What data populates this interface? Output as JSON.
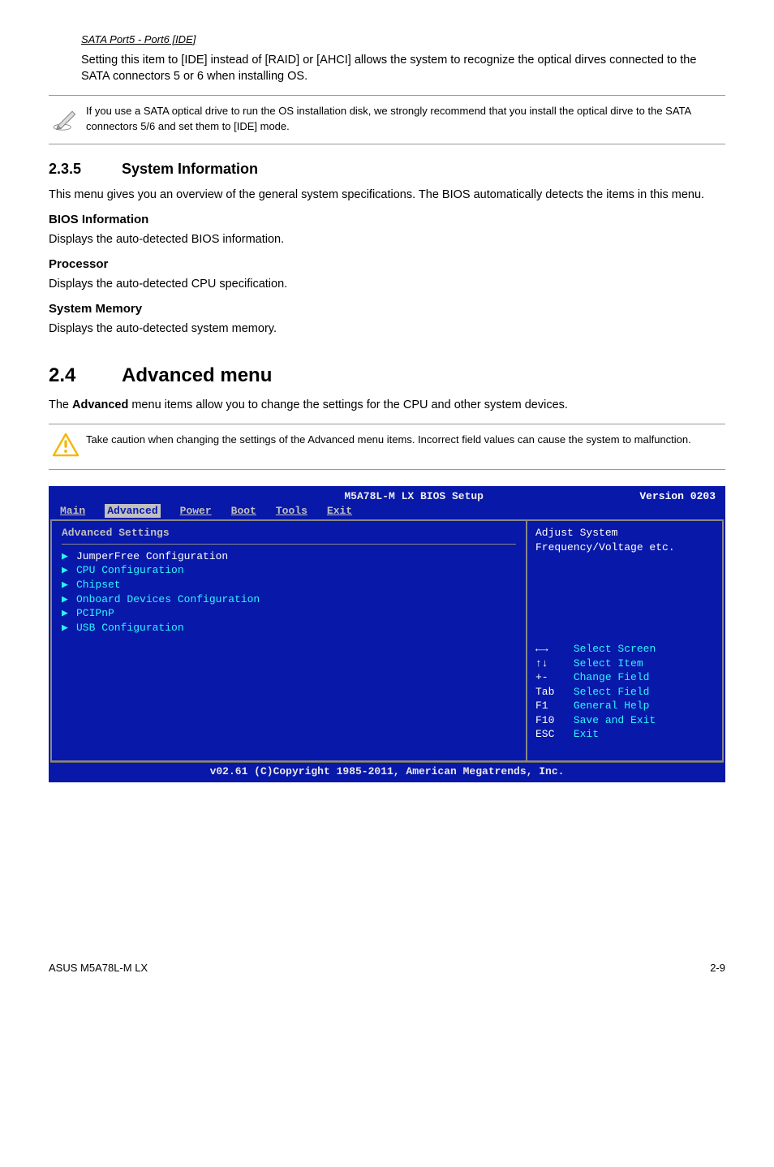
{
  "sata": {
    "heading": "SATA Port5 - Port6 [IDE]",
    "body": "Setting this item to [IDE] instead of [RAID] or [AHCI] allows the system to recognize the optical dirves connected to the SATA connectors 5 or 6 when installing OS."
  },
  "note1": {
    "text": "If you use a SATA optical drive to run the OS installation disk, we strongly recommend that you install the optical dirve to the SATA connectors 5/6 and set them to [IDE] mode."
  },
  "section235": {
    "num": "2.3.5",
    "title": "System Information",
    "intro": "This menu gives you an overview of the general system specifications. The BIOS automatically detects the items in this menu.",
    "bios_h": "BIOS Information",
    "bios_t": "Displays the auto-detected BIOS information.",
    "proc_h": "Processor",
    "proc_t": "Displays the auto-detected CPU specification.",
    "mem_h": "System Memory",
    "mem_t": "Displays the auto-detected system memory."
  },
  "section24": {
    "num": "2.4",
    "title": "Advanced menu",
    "intro_prefix": "The ",
    "intro_bold": "Advanced",
    "intro_suffix": " menu items allow you to change the settings for the CPU and other system devices."
  },
  "caution": {
    "text": "Take caution when changing the settings of the Advanced menu items. Incorrect field values can cause the system to malfunction."
  },
  "bios": {
    "title": "M5A78L-M LX BIOS Setup",
    "version": "Version 0203",
    "tabs": {
      "main": "Main",
      "advanced": "Advanced",
      "power": "Power",
      "boot": "Boot",
      "tools": "Tools",
      "exit": "Exit"
    },
    "settings_title": "Advanced Settings",
    "items": {
      "i0": "JumperFree Configuration",
      "i1": "CPU Configuration",
      "i2": "Chipset",
      "i3": "Onboard Devices Configuration",
      "i4": "PCIPnP",
      "i5": "USB Configuration"
    },
    "help": "Adjust System Frequency/Voltage etc.",
    "keys": {
      "k0l": "←→",
      "k0r": "Select Screen",
      "k1l": "↑↓",
      "k1r": "Select Item",
      "k2l": "+-",
      "k2r": "Change Field",
      "k3l": "Tab",
      "k3r": "Select Field",
      "k4l": "F1",
      "k4r": "General Help",
      "k5l": "F10",
      "k5r": "Save and Exit",
      "k6l": "ESC",
      "k6r": "Exit"
    },
    "footer": "v02.61 (C)Copyright 1985-2011, American Megatrends, Inc."
  },
  "footer": {
    "left": "ASUS M5A78L-M LX",
    "right": "2-9"
  }
}
